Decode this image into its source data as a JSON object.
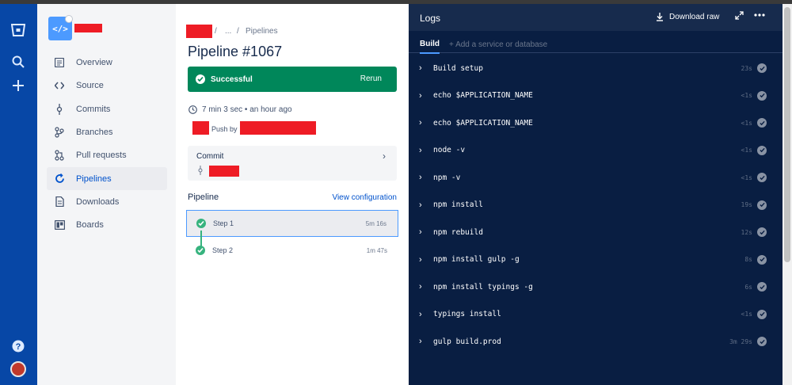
{
  "global_nav": {
    "icons": [
      "bitbucket-logo",
      "search",
      "create",
      "help",
      "avatar"
    ]
  },
  "sidebar": {
    "items": [
      {
        "label": "Overview",
        "icon": "overview-icon"
      },
      {
        "label": "Source",
        "icon": "source-icon"
      },
      {
        "label": "Commits",
        "icon": "commits-icon"
      },
      {
        "label": "Branches",
        "icon": "branches-icon"
      },
      {
        "label": "Pull requests",
        "icon": "pull-requests-icon"
      },
      {
        "label": "Pipelines",
        "icon": "pipelines-icon",
        "active": true
      },
      {
        "label": "Downloads",
        "icon": "downloads-icon"
      },
      {
        "label": "Boards",
        "icon": "boards-icon"
      }
    ]
  },
  "main": {
    "breadcrumb": {
      "sep": "/",
      "ellipsis": "...",
      "current": "Pipelines"
    },
    "title": "Pipeline #1067",
    "status": {
      "label": "Successful",
      "rerun": "Rerun",
      "color": "#00875a"
    },
    "meta": "7 min 3 sec • an hour ago",
    "push_by": "Push by",
    "commit_label": "Commit",
    "pipeline_label": "Pipeline",
    "view_config": "View configuration",
    "steps": [
      {
        "name": "Step 1",
        "duration": "5m 16s"
      },
      {
        "name": "Step 2",
        "duration": "1m 47s"
      }
    ]
  },
  "logs": {
    "title": "Logs",
    "download_raw": "Download raw",
    "tab_build": "Build",
    "tab_add": "+ Add a service or database",
    "rows": [
      {
        "cmd": "Build setup",
        "time": "23s"
      },
      {
        "cmd": "echo $APPLICATION_NAME",
        "time": "<1s"
      },
      {
        "cmd": "echo $APPLICATION_NAME",
        "time": "<1s"
      },
      {
        "cmd": "node -v",
        "time": "<1s"
      },
      {
        "cmd": "npm -v",
        "time": "<1s"
      },
      {
        "cmd": "npm install",
        "time": "19s"
      },
      {
        "cmd": "npm rebuild",
        "time": "12s"
      },
      {
        "cmd": "npm install gulp -g",
        "time": "8s"
      },
      {
        "cmd": "npm install typings -g",
        "time": "6s"
      },
      {
        "cmd": "typings install",
        "time": "<1s"
      },
      {
        "cmd": "gulp build.prod",
        "time": "3m 29s"
      }
    ]
  }
}
